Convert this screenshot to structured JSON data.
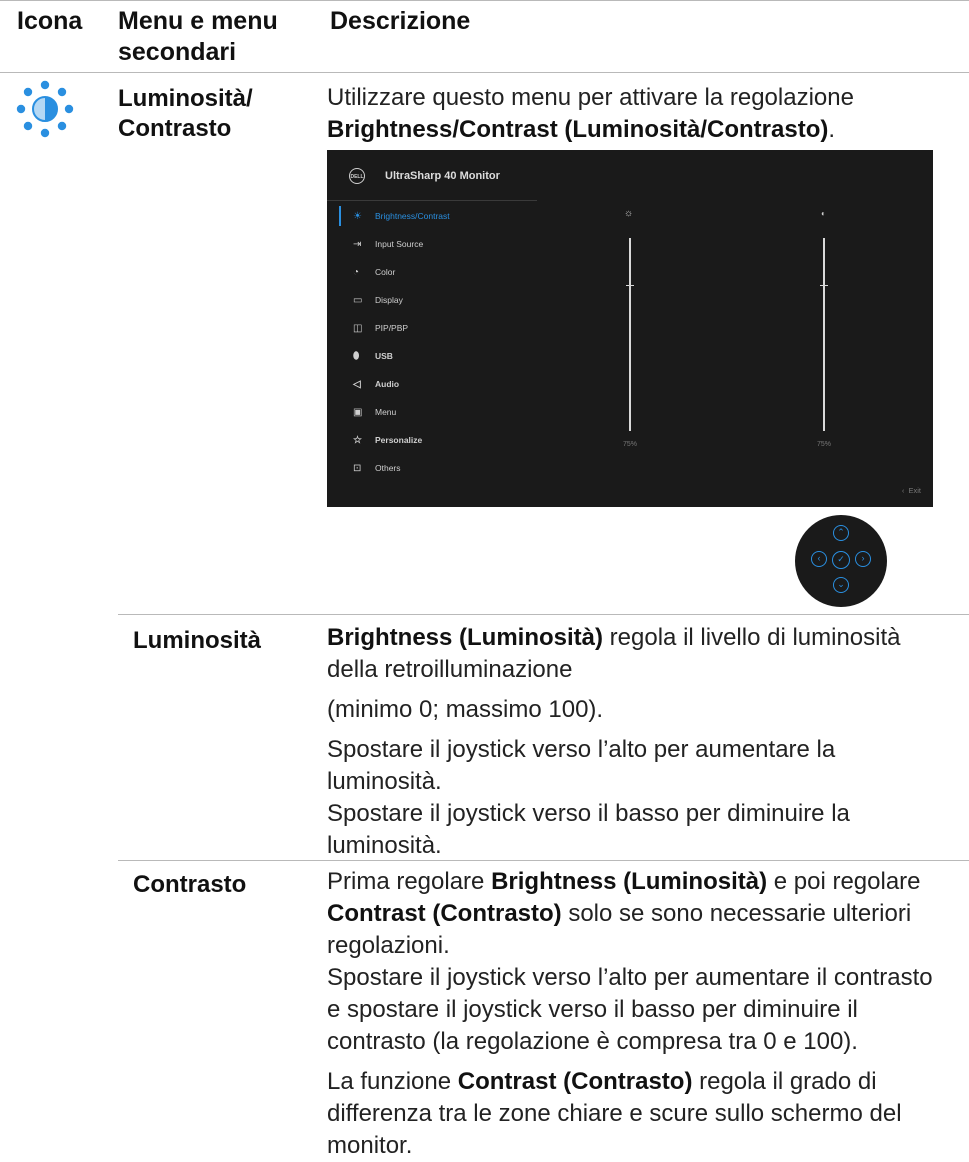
{
  "header": {
    "col_icon": "Icona",
    "col_menu_line1": "Menu e menu",
    "col_menu_line2": "secondari",
    "col_desc": "Descrizione"
  },
  "main_row": {
    "icon": "brightness-contrast-icon",
    "title_line1": "Luminosità/",
    "title_line2": "Contrasto",
    "desc_line1": "Utilizzare questo menu per attivare la regolazione",
    "desc_bold": "Brightness/Contrast (Luminosità/Contrasto)",
    "desc_end": "."
  },
  "osd": {
    "brand": "DELL",
    "title": "UltraSharp 40 Monitor",
    "menu": [
      {
        "label": "Brightness/Contrast",
        "icon": "sun-icon"
      },
      {
        "label": "Input Source",
        "icon": "input-icon"
      },
      {
        "label": "Color",
        "icon": "palette-icon"
      },
      {
        "label": "Display",
        "icon": "monitor-icon"
      },
      {
        "label": "PIP/PBP",
        "icon": "pip-icon"
      },
      {
        "label": "USB",
        "icon": "mouse-icon"
      },
      {
        "label": "Audio",
        "icon": "speaker-icon"
      },
      {
        "label": "Menu",
        "icon": "menu-icon"
      },
      {
        "label": "Personalize",
        "icon": "star-icon"
      },
      {
        "label": "Others",
        "icon": "others-icon"
      }
    ],
    "brightness_value": "75%",
    "contrast_value": "75%",
    "exit_label": "Exit",
    "accent": "#2a8fe0"
  },
  "brightness_row": {
    "label": "Luminosità",
    "p1_bold": "Brightness (Luminosità)",
    "p1_rest": " regola il livello di luminosità",
    "p1_line2": "della retroilluminazione",
    "p2": "(minimo 0; massimo 100).",
    "p3_line1": "Spostare il joystick verso l’alto per aumentare la",
    "p3_line2": "luminosità.",
    "p3_line3": "Spostare il joystick verso il basso per diminuire la",
    "p3_line4": "luminosità."
  },
  "contrast_row": {
    "label": "Contrasto",
    "l1_pre": "Prima regolare ",
    "l1_bold": "Brightness (Luminosità)",
    "l1_post": " e poi regolare",
    "l2_bold": "Contrast (Contrasto)",
    "l2_post": " solo se sono necessarie ulteriori",
    "l3": "regolazioni.",
    "l4": "Spostare il joystick verso l’alto per aumentare il contrasto",
    "l5": "e spostare il joystick verso il basso per diminuire il",
    "l6": "contrasto (la regolazione è compresa tra 0 e 100).",
    "p2_pre": "La funzione ",
    "p2_bold": "Contrast (Contrasto)",
    "p2_post": " regola il grado di",
    "p2_l2": "differenza tra le zone chiare e scure sullo schermo del",
    "p2_l3": "monitor."
  }
}
